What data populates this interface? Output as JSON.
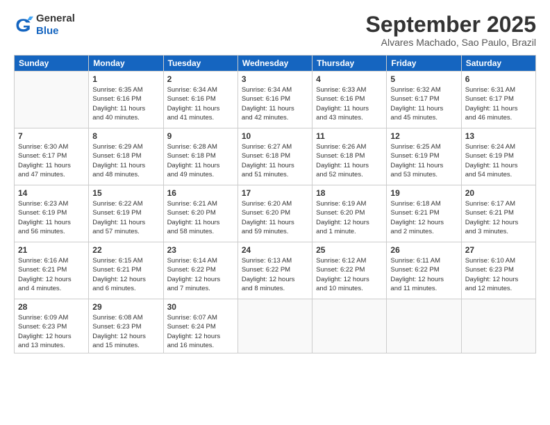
{
  "logo": {
    "line1": "General",
    "line2": "Blue"
  },
  "title": "September 2025",
  "subtitle": "Alvares Machado, Sao Paulo, Brazil",
  "days_of_week": [
    "Sunday",
    "Monday",
    "Tuesday",
    "Wednesday",
    "Thursday",
    "Friday",
    "Saturday"
  ],
  "weeks": [
    [
      {
        "day": "",
        "info": ""
      },
      {
        "day": "1",
        "info": "Sunrise: 6:35 AM\nSunset: 6:16 PM\nDaylight: 11 hours\nand 40 minutes."
      },
      {
        "day": "2",
        "info": "Sunrise: 6:34 AM\nSunset: 6:16 PM\nDaylight: 11 hours\nand 41 minutes."
      },
      {
        "day": "3",
        "info": "Sunrise: 6:34 AM\nSunset: 6:16 PM\nDaylight: 11 hours\nand 42 minutes."
      },
      {
        "day": "4",
        "info": "Sunrise: 6:33 AM\nSunset: 6:16 PM\nDaylight: 11 hours\nand 43 minutes."
      },
      {
        "day": "5",
        "info": "Sunrise: 6:32 AM\nSunset: 6:17 PM\nDaylight: 11 hours\nand 45 minutes."
      },
      {
        "day": "6",
        "info": "Sunrise: 6:31 AM\nSunset: 6:17 PM\nDaylight: 11 hours\nand 46 minutes."
      }
    ],
    [
      {
        "day": "7",
        "info": "Sunrise: 6:30 AM\nSunset: 6:17 PM\nDaylight: 11 hours\nand 47 minutes."
      },
      {
        "day": "8",
        "info": "Sunrise: 6:29 AM\nSunset: 6:18 PM\nDaylight: 11 hours\nand 48 minutes."
      },
      {
        "day": "9",
        "info": "Sunrise: 6:28 AM\nSunset: 6:18 PM\nDaylight: 11 hours\nand 49 minutes."
      },
      {
        "day": "10",
        "info": "Sunrise: 6:27 AM\nSunset: 6:18 PM\nDaylight: 11 hours\nand 51 minutes."
      },
      {
        "day": "11",
        "info": "Sunrise: 6:26 AM\nSunset: 6:18 PM\nDaylight: 11 hours\nand 52 minutes."
      },
      {
        "day": "12",
        "info": "Sunrise: 6:25 AM\nSunset: 6:19 PM\nDaylight: 11 hours\nand 53 minutes."
      },
      {
        "day": "13",
        "info": "Sunrise: 6:24 AM\nSunset: 6:19 PM\nDaylight: 11 hours\nand 54 minutes."
      }
    ],
    [
      {
        "day": "14",
        "info": "Sunrise: 6:23 AM\nSunset: 6:19 PM\nDaylight: 11 hours\nand 56 minutes."
      },
      {
        "day": "15",
        "info": "Sunrise: 6:22 AM\nSunset: 6:19 PM\nDaylight: 11 hours\nand 57 minutes."
      },
      {
        "day": "16",
        "info": "Sunrise: 6:21 AM\nSunset: 6:20 PM\nDaylight: 11 hours\nand 58 minutes."
      },
      {
        "day": "17",
        "info": "Sunrise: 6:20 AM\nSunset: 6:20 PM\nDaylight: 11 hours\nand 59 minutes."
      },
      {
        "day": "18",
        "info": "Sunrise: 6:19 AM\nSunset: 6:20 PM\nDaylight: 12 hours\nand 1 minute."
      },
      {
        "day": "19",
        "info": "Sunrise: 6:18 AM\nSunset: 6:21 PM\nDaylight: 12 hours\nand 2 minutes."
      },
      {
        "day": "20",
        "info": "Sunrise: 6:17 AM\nSunset: 6:21 PM\nDaylight: 12 hours\nand 3 minutes."
      }
    ],
    [
      {
        "day": "21",
        "info": "Sunrise: 6:16 AM\nSunset: 6:21 PM\nDaylight: 12 hours\nand 4 minutes."
      },
      {
        "day": "22",
        "info": "Sunrise: 6:15 AM\nSunset: 6:21 PM\nDaylight: 12 hours\nand 6 minutes."
      },
      {
        "day": "23",
        "info": "Sunrise: 6:14 AM\nSunset: 6:22 PM\nDaylight: 12 hours\nand 7 minutes."
      },
      {
        "day": "24",
        "info": "Sunrise: 6:13 AM\nSunset: 6:22 PM\nDaylight: 12 hours\nand 8 minutes."
      },
      {
        "day": "25",
        "info": "Sunrise: 6:12 AM\nSunset: 6:22 PM\nDaylight: 12 hours\nand 10 minutes."
      },
      {
        "day": "26",
        "info": "Sunrise: 6:11 AM\nSunset: 6:22 PM\nDaylight: 12 hours\nand 11 minutes."
      },
      {
        "day": "27",
        "info": "Sunrise: 6:10 AM\nSunset: 6:23 PM\nDaylight: 12 hours\nand 12 minutes."
      }
    ],
    [
      {
        "day": "28",
        "info": "Sunrise: 6:09 AM\nSunset: 6:23 PM\nDaylight: 12 hours\nand 13 minutes."
      },
      {
        "day": "29",
        "info": "Sunrise: 6:08 AM\nSunset: 6:23 PM\nDaylight: 12 hours\nand 15 minutes."
      },
      {
        "day": "30",
        "info": "Sunrise: 6:07 AM\nSunset: 6:24 PM\nDaylight: 12 hours\nand 16 minutes."
      },
      {
        "day": "",
        "info": ""
      },
      {
        "day": "",
        "info": ""
      },
      {
        "day": "",
        "info": ""
      },
      {
        "day": "",
        "info": ""
      }
    ]
  ]
}
